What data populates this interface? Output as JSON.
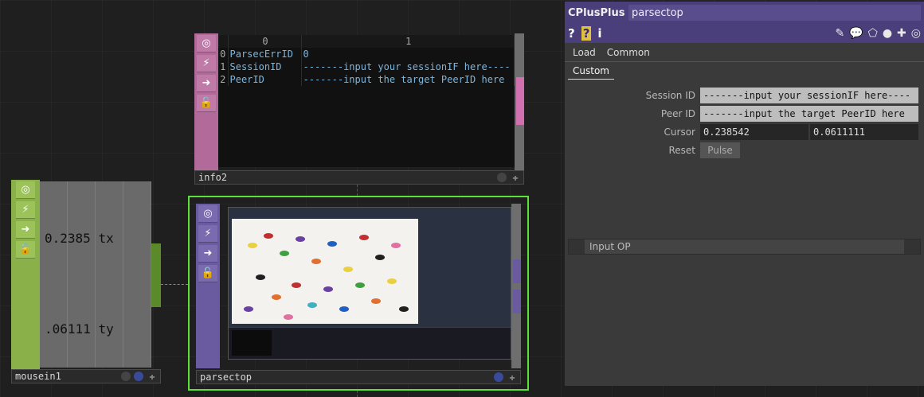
{
  "info2": {
    "name": "info2",
    "columns": [
      "",
      "0",
      "1"
    ],
    "rows": [
      {
        "idx": "0",
        "key": "ParsecErrID",
        "value": "0"
      },
      {
        "idx": "1",
        "key": "SessionID",
        "value": "-------input your sessionIF here----"
      },
      {
        "idx": "2",
        "key": "PeerID",
        "value": "-------input the target PeerID here"
      }
    ]
  },
  "mousein1": {
    "name": "mousein1",
    "tx": "0.2385",
    "tx_label": "tx",
    "ty": ".06111",
    "ty_label": "ty"
  },
  "parsectop": {
    "name": "parsectop"
  },
  "panel": {
    "op_type": "CPlusPlus",
    "op_name": "parsectop",
    "left_icons": [
      "?",
      "?",
      "i"
    ],
    "pages": [
      "Load",
      "Common"
    ],
    "active_page": "Custom",
    "params": {
      "session_label": "Session ID",
      "session_value": "-------input your sessionIF here----",
      "peer_label": "Peer ID",
      "peer_value": "-------input the target PeerID here",
      "cursor_label": "Cursor",
      "cursor_x": "0.238542",
      "cursor_y": "0.0611111",
      "reset_label": "Reset",
      "reset_button": "Pulse"
    },
    "input_op": "Input OP"
  },
  "colors": {
    "info_dat": "#b26a9a",
    "chop": "#8ab04a",
    "top": "#6a5aa0",
    "selected": "#5ee03a",
    "panel_header": "#4a3f7a"
  }
}
